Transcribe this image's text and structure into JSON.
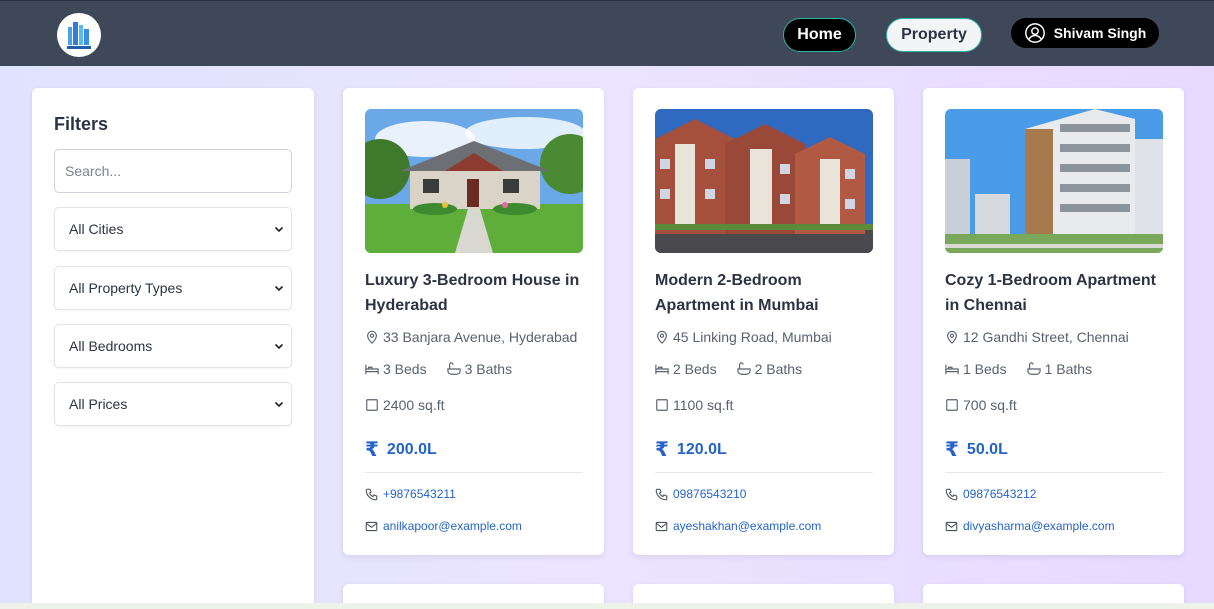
{
  "nav": {
    "home_label": "Home",
    "property_label": "Property",
    "user_name": "Shivam Singh"
  },
  "filters": {
    "title": "Filters",
    "search_placeholder": "Search...",
    "city": "All Cities",
    "property_type": "All Property Types",
    "bedrooms": "All Bedrooms",
    "prices": "All Prices"
  },
  "cards": [
    {
      "title": "Luxury 3-Bedroom House in Hyderabad",
      "address": "33 Banjara Avenue, Hyderabad",
      "beds": "3 Beds",
      "baths": "3 Baths",
      "area": "2400 sq.ft",
      "price": "200.0L",
      "phone": "+9876543211",
      "email": "anilkapoor@example.com"
    },
    {
      "title": "Modern 2-Bedroom Apartment in Mumbai",
      "address": "45 Linking Road, Mumbai",
      "beds": "2 Beds",
      "baths": "2 Baths",
      "area": "1100 sq.ft",
      "price": "120.0L",
      "phone": "09876543210",
      "email": "ayeshakhan@example.com"
    },
    {
      "title": "Cozy 1-Bedroom Apartment in Chennai",
      "address": "12 Gandhi Street, Chennai",
      "beds": "1 Beds",
      "baths": "1 Baths",
      "area": "700 sq.ft",
      "price": "50.0L",
      "phone": "09876543212",
      "email": "divyasharma@example.com"
    }
  ],
  "currency_symbol": "₹",
  "colors": {
    "navbar": "#3e4858",
    "accent": "#2563c9",
    "nav_border": "#2bb6a4"
  }
}
